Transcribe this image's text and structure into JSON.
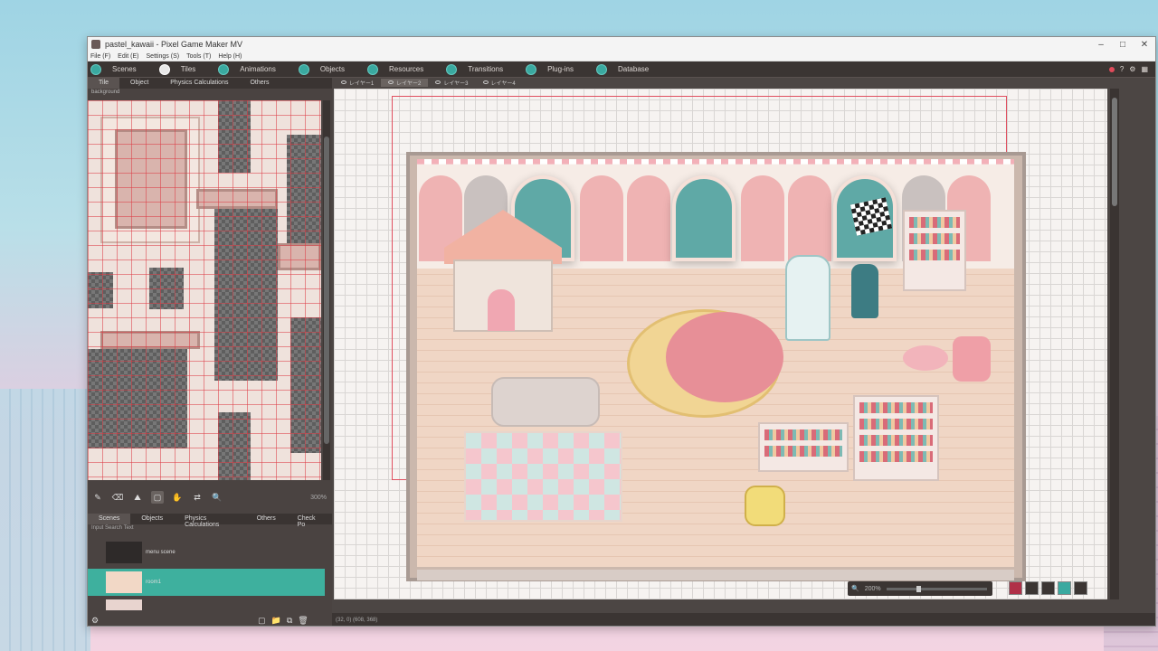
{
  "window": {
    "title": "pastel_kawaii - Pixel Game Maker MV"
  },
  "menubar": {
    "items": [
      "File (F)",
      "Edit (E)",
      "Settings (S)",
      "Tools (T)",
      "Help (H)"
    ]
  },
  "toolbar": {
    "tabs": [
      {
        "label": "Scenes",
        "icon": "scenes-icon"
      },
      {
        "label": "Tiles",
        "icon": "tiles-icon",
        "active": true
      },
      {
        "label": "Animations",
        "icon": "animations-icon"
      },
      {
        "label": "Objects",
        "icon": "objects-icon"
      },
      {
        "label": "Resources",
        "icon": "resources-icon"
      },
      {
        "label": "Transitions",
        "icon": "transitions-icon"
      },
      {
        "label": "Plug-ins",
        "icon": "plugins-icon"
      },
      {
        "label": "Database",
        "icon": "database-icon"
      }
    ],
    "help": "?"
  },
  "left_panel": {
    "tabs": [
      "Tile",
      "Object",
      "Physics Calculations",
      "Others"
    ],
    "tileset_name": "background",
    "zoom": "300%"
  },
  "scenes_panel": {
    "tabs": [
      "Scenes",
      "Objects",
      "Physics Calculations",
      "Others",
      "Check Po"
    ],
    "search_placeholder": "Input Search Text",
    "items": [
      {
        "label": "menu scene",
        "selected": false
      },
      {
        "label": "room1",
        "selected": true
      },
      {
        "label": "",
        "selected": false
      }
    ]
  },
  "main": {
    "layers": [
      {
        "label": "レイヤー1",
        "active": false
      },
      {
        "label": "レイヤー2",
        "active": true
      },
      {
        "label": "レイヤー3",
        "active": false
      },
      {
        "label": "レイヤー4",
        "active": false
      }
    ],
    "zoom": "200%",
    "status": "(32, 0) (608, 368)"
  },
  "colors": {
    "accent": "#3eb09e",
    "toolbar_bg": "#3b3533",
    "frame": "#e05060"
  }
}
